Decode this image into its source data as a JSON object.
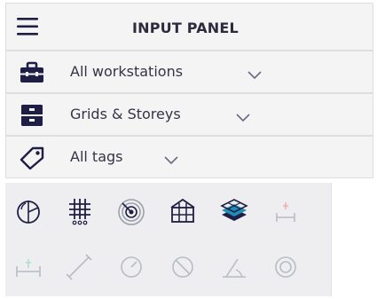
{
  "header": {
    "title": "INPUT PANEL",
    "menu_icon": "hamburger-menu-icon"
  },
  "dropdowns": [
    {
      "label": "All workstations",
      "icon": "briefcase-icon"
    },
    {
      "label": "Grids & Storeys",
      "icon": "storeys-cabinet-icon"
    },
    {
      "label": "All tags",
      "icon": "tag-icon"
    }
  ],
  "tools": {
    "row1": [
      "circular-grid-icon",
      "rectangular-grid-icon",
      "radial-grid-icon",
      "structure-frame-icon",
      "storey-layers-icon",
      "level-dimension-icon"
    ],
    "row2": [
      "dimension-icon",
      "aligned-dimension-icon",
      "radius-dimension-icon",
      "diameter-dimension-icon",
      "angle-dimension-icon",
      "arc-length-icon"
    ]
  },
  "colors": {
    "icon_dark": "#1e1e46",
    "icon_disabled": "#b8bcc4",
    "panel_bg": "#f4f4f5",
    "toolbar_bg": "#eeeef0"
  }
}
